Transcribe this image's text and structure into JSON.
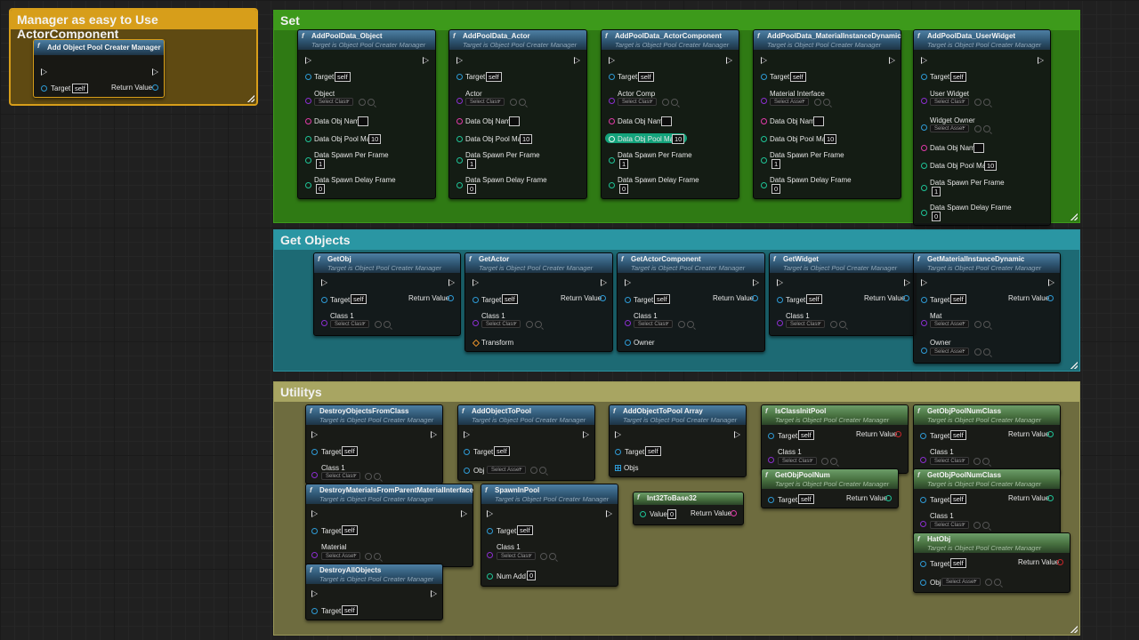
{
  "icons": {
    "function": "f"
  },
  "colors": {
    "pin_object": "#2e9bd6",
    "pin_class": "#8b2ed0",
    "pin_name": "#e03aa8",
    "pin_int": "#1fc497",
    "pin_bool": "#c8262a",
    "pin_transform": "#f0962c",
    "comment_manager": "#d79e1a",
    "comment_set": "#2f7a14",
    "comment_get": "#1d7580",
    "comment_util": "#7a7846"
  },
  "comments": {
    "manager": "Manager as easy to Use ActorComponent",
    "set": "Set",
    "get": "Get Objects",
    "util": "Utilitys"
  },
  "common": {
    "target_is": "Target is Object Pool Creater Manager",
    "target": "Target",
    "self": "self",
    "return_value": "Return Value",
    "select_class": "Select Class",
    "select_asset": "Select Asset",
    "class_1": "Class 1",
    "data_obj_name": "Data Obj Name",
    "data_obj_pool_max": "Data Obj Pool Max",
    "data_spawn_per_frame": "Data Spawn Per Frame",
    "data_spawn_delay_frame": "Data Spawn Delay Frame",
    "v10": "10",
    "v1": "1",
    "v0": "0"
  },
  "nodes": {
    "add_manager": "Add Object Pool Creater Manager",
    "set_object": {
      "title": "AddPoolData_Object",
      "pin": "Object"
    },
    "set_actor": {
      "title": "AddPoolData_Actor",
      "pin": "Actor"
    },
    "set_actor_comp": {
      "title": "AddPoolData_ActorComponent",
      "pin": "Actor Comp"
    },
    "set_mid": {
      "title": "AddPoolData_MaterialInstanceDynamic",
      "pin": "Material Interface"
    },
    "set_widget": {
      "title": "AddPoolData_UserWidget",
      "pin": "User Widget",
      "pin2": "Widget Owner"
    },
    "get_obj": "GetObj",
    "get_actor": {
      "title": "GetActor",
      "pin": "Transform"
    },
    "get_actor_comp": {
      "title": "GetActorComponent",
      "pin": "Owner"
    },
    "get_widget": "GetWidget",
    "get_mid": {
      "title": "GetMaterialInstanceDynamic",
      "pin1": "Mat",
      "pin2": "Owner"
    },
    "destroy_from_class": "DestroyObjectsFromClass",
    "add_to_pool": {
      "title": "AddObjectToPool",
      "pin": "Obj"
    },
    "add_to_pool_array": {
      "title": "AddObjectToPool Array",
      "pin": "Objs"
    },
    "is_class_init": "IsClassInitPool",
    "get_pool_num_class_1": "GetObjPoolNumClass",
    "destroy_materials": {
      "title": "DestroyMaterialsFromParentMaterialInterface",
      "pin": "Material"
    },
    "spawn_in_pool": {
      "title": "SpawnInPool",
      "pin": "Num Add"
    },
    "int32_to_base32": {
      "title": "Int32ToBase32",
      "pin": "Value"
    },
    "get_pool_num": "GetObjPoolNum",
    "get_pool_num_class_2": "GetObjPoolNumClass",
    "destroy_all": "DestroyAllObjects",
    "hat_obj": {
      "title": "HatObj",
      "pin": "Obj"
    }
  }
}
